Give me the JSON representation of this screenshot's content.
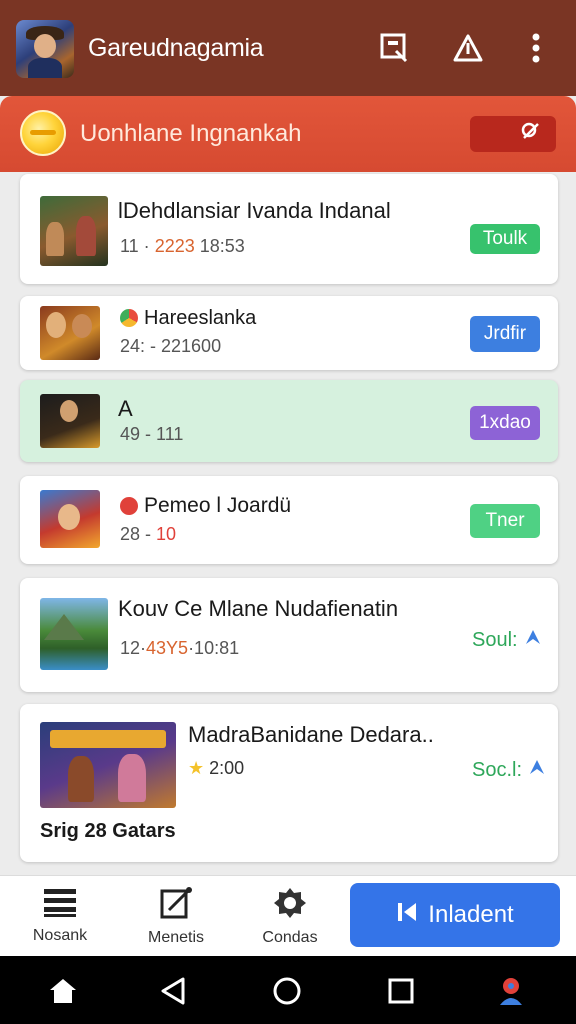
{
  "app": {
    "title": "Gareudnagamia"
  },
  "banner": {
    "title": "Uonhlane Ingnankah"
  },
  "cards": [
    {
      "title": "lDehdlansiar Ivanda Indanal",
      "meta_prefix": "11 ·",
      "meta_accent": "2223",
      "meta_suffix": "18:53",
      "action": "Toulk",
      "action_color": "#37c26d"
    },
    {
      "title": "Hareeslanka",
      "meta": "24: - 221600",
      "action": "Jrdfir",
      "action_color": "#3d7fe0"
    },
    {
      "title": "A",
      "meta": "49 - 111",
      "action": "1xdao",
      "action_color": "#8d63d6"
    },
    {
      "title": "Pemeo l Joardü",
      "meta_prefix": "28 -",
      "meta_accent": "10",
      "action": "Tner",
      "action_color": "#4fd184"
    },
    {
      "title": "Kouv Ce Mlane Nudafienatin",
      "meta_prefix": "12·",
      "meta_accent": "43Y5",
      "meta_suffix": "·10:81",
      "side": "Soul:"
    },
    {
      "title": "MadraBanidane Dedara..",
      "meta": "2:00",
      "side": "Soc.l:",
      "footer": "Srig 28 Gatars"
    }
  ],
  "bottom_nav": {
    "item1": "Nosank",
    "item2": "Menetis",
    "item3": "Condas",
    "cta": "Inladent"
  },
  "colors": {
    "app_bar": "#7a3524",
    "banner": "#d64a31",
    "cta": "#3474e8",
    "highlight_row": "#d6f1de"
  },
  "icons": [
    "app-logo",
    "cast-icon",
    "share-icon",
    "more-vert-icon",
    "coin-icon",
    "search-icon",
    "list-icon",
    "edit-icon",
    "badge-icon",
    "skip-back-icon",
    "home-icon",
    "back-icon",
    "circle-home-icon",
    "recents-icon",
    "assistant-icon"
  ]
}
